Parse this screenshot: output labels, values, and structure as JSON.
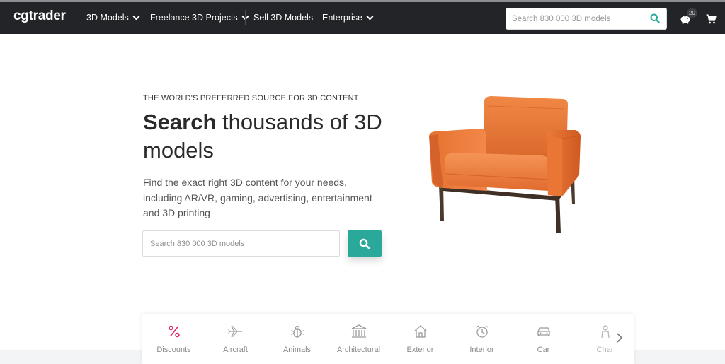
{
  "navbar": {
    "logo": "cgtrader",
    "items": [
      {
        "label": "3D Models",
        "has_dropdown": true
      },
      {
        "label": "Freelance 3D Projects",
        "has_dropdown": true
      },
      {
        "label": "Sell 3D Models",
        "has_dropdown": false
      },
      {
        "label": "Enterprise",
        "has_dropdown": true
      }
    ],
    "search_placeholder": "Search 830 000 3D models",
    "piggy_badge": "20"
  },
  "hero": {
    "eyebrow": "THE WORLD'S PREFERRED SOURCE FOR 3D CONTENT",
    "headline_bold": "Search",
    "headline_rest": " thousands of 3D models",
    "subtext": "Find the exact right 3D content for your needs, including AR/VR, gaming, advertising, entertainment and 3D printing",
    "search_placeholder": "Search 830 000 3D models"
  },
  "categories": [
    {
      "label": "Discounts",
      "icon": "percent-icon"
    },
    {
      "label": "Aircraft",
      "icon": "airplane-icon"
    },
    {
      "label": "Animals",
      "icon": "bug-icon"
    },
    {
      "label": "Architectural",
      "icon": "building-icon"
    },
    {
      "label": "Exterior",
      "icon": "house-icon"
    },
    {
      "label": "Interior",
      "icon": "alarm-clock-icon"
    },
    {
      "label": "Car",
      "icon": "car-icon"
    },
    {
      "label": "Char",
      "icon": "character-icon"
    }
  ],
  "colors": {
    "navbar": "#222427",
    "accent": "#2aa99a",
    "discount": "#e0245e"
  }
}
